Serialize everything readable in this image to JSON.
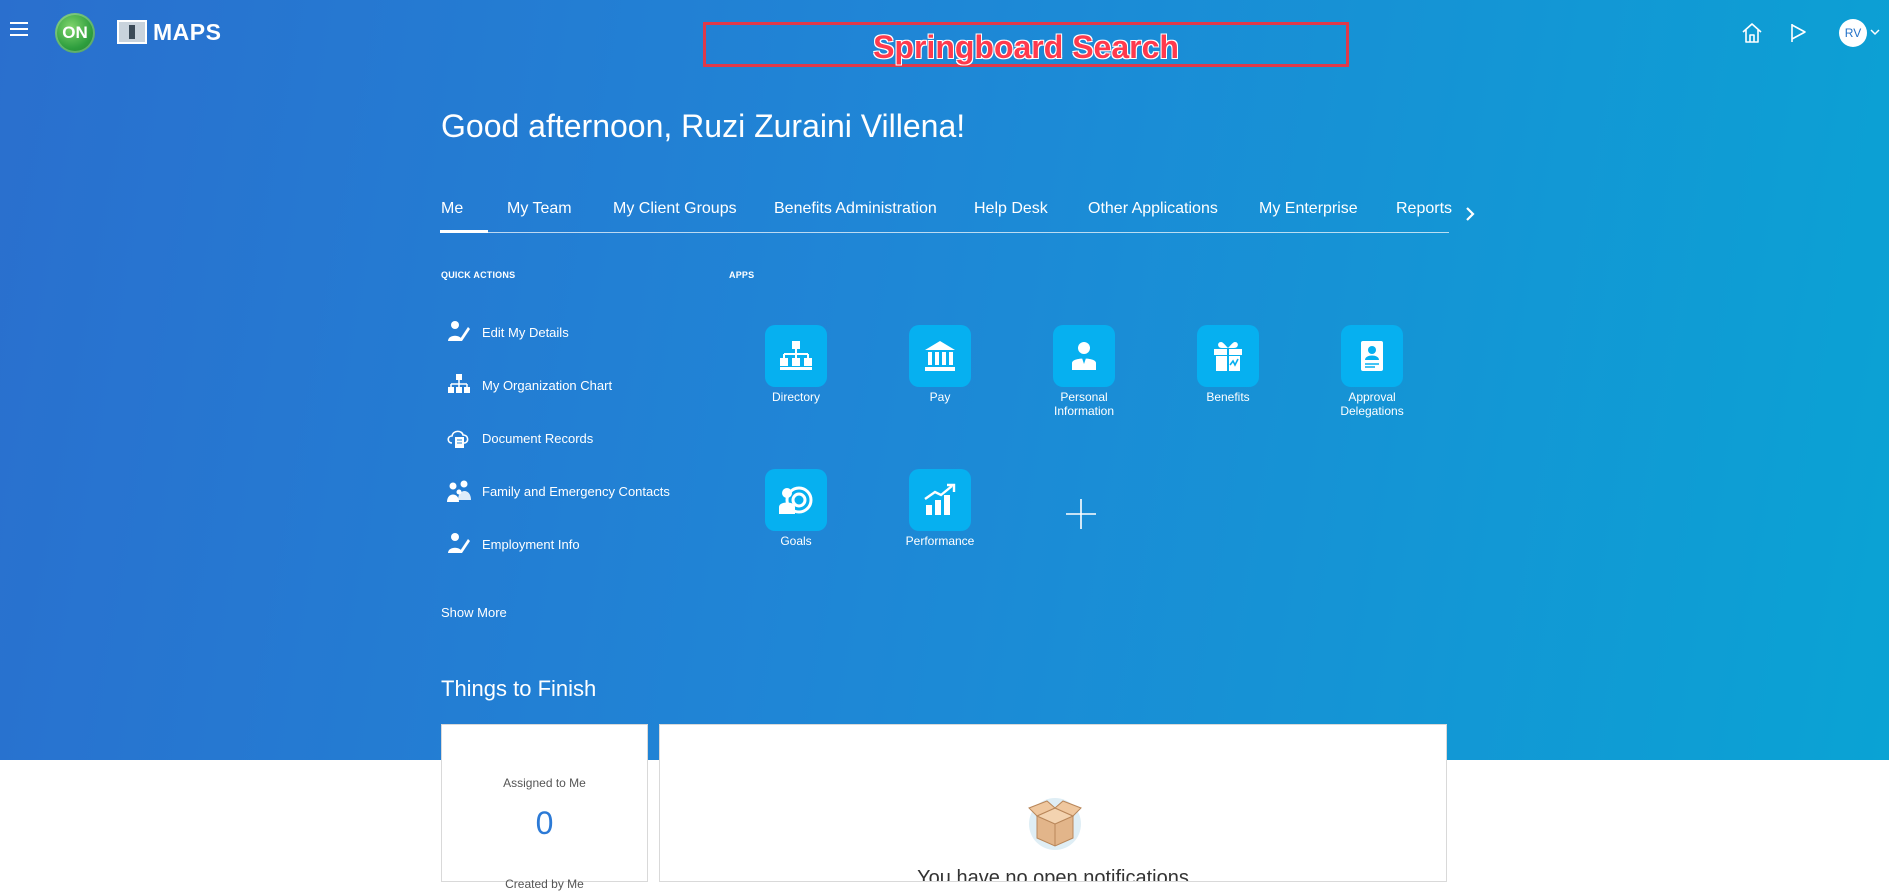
{
  "header": {
    "logo_on_text": "ON",
    "logo_maps_text": "MAPS",
    "search_label": "Springboard Search",
    "avatar_initials": "RV"
  },
  "greeting": "Good afternoon, Ruzi Zuraini Villena!",
  "tabs": [
    {
      "label": "Me",
      "active": true
    },
    {
      "label": "My Team"
    },
    {
      "label": "My Client Groups"
    },
    {
      "label": "Benefits Administration"
    },
    {
      "label": "Help Desk"
    },
    {
      "label": "Other Applications"
    },
    {
      "label": "My Enterprise"
    },
    {
      "label": "Reports"
    }
  ],
  "quick_actions": {
    "heading": "QUICK ACTIONS",
    "items": [
      {
        "label": "Edit My Details",
        "icon": "edit-person-icon"
      },
      {
        "label": "My Organization Chart",
        "icon": "org-chart-icon"
      },
      {
        "label": "Document Records",
        "icon": "document-cloud-icon"
      },
      {
        "label": "Family and Emergency Contacts",
        "icon": "family-icon"
      },
      {
        "label": "Employment Info",
        "icon": "edit-person-icon"
      }
    ],
    "show_more": "Show More"
  },
  "apps": {
    "heading": "APPS",
    "items": [
      {
        "label": "Directory",
        "icon": "directory-icon"
      },
      {
        "label": "Pay",
        "icon": "bank-icon"
      },
      {
        "label": "Personal Information",
        "icon": "person-card-icon"
      },
      {
        "label": "Benefits",
        "icon": "gift-icon"
      },
      {
        "label": "Approval Delegations",
        "icon": "approval-icon"
      },
      {
        "label": "Goals",
        "icon": "goals-icon"
      },
      {
        "label": "Performance",
        "icon": "performance-chart-icon"
      }
    ]
  },
  "things_to_finish": {
    "title": "Things to Finish",
    "assigned_label": "Assigned to Me",
    "assigned_count": "0",
    "created_label": "Created by Me",
    "empty_message": "You have no open notifications"
  },
  "colors": {
    "hero_start": "#2a6fce",
    "hero_end": "#0aa3d4",
    "app_tile": "#06b0f0",
    "annotation_red": "#e0394a"
  }
}
